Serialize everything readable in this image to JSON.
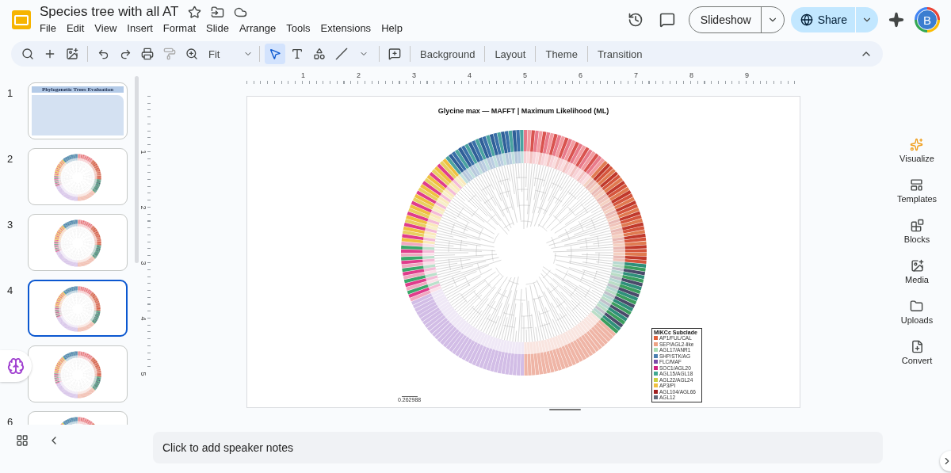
{
  "document": {
    "title": "Species tree with all AT"
  },
  "menu": [
    "File",
    "Edit",
    "View",
    "Insert",
    "Format",
    "Slide",
    "Arrange",
    "Tools",
    "Extensions",
    "Help"
  ],
  "header": {
    "slideshow": "Slideshow",
    "share": "Share",
    "avatar": "B"
  },
  "toolbar": {
    "zoom": "Fit",
    "pointer_selected": true,
    "buttons": [
      "Background",
      "Layout",
      "Theme",
      "Transition"
    ]
  },
  "slides": [
    {
      "number": "1",
      "kind": "title",
      "selected": false,
      "title": "Phylogenetic Trees Evaluation"
    },
    {
      "number": "2",
      "kind": "tree",
      "selected": false
    },
    {
      "number": "3",
      "kind": "tree",
      "selected": false
    },
    {
      "number": "4",
      "kind": "tree",
      "selected": true
    },
    {
      "kind": "tree",
      "selected": false
    },
    {
      "number": "6",
      "kind": "tree",
      "selected": false
    }
  ],
  "ruler": {
    "horizontal": [
      "1",
      "2",
      "3",
      "4",
      "5",
      "6",
      "7",
      "8",
      "9"
    ],
    "vertical": [
      "1",
      "2",
      "3",
      "4",
      "5"
    ]
  },
  "slide": {
    "title": "Glycine max — MAFFT | Maximum Likelihood (ML)",
    "scale": "0.262988",
    "legend": {
      "title": "MIKCc Subclade",
      "items": [
        {
          "label": "AP1/FUL/CAL",
          "color": "#e0603a"
        },
        {
          "label": "SEP/AGL2-like",
          "color": "#eda283"
        },
        {
          "label": "AGL17/ANR1",
          "color": "#a8dcb0"
        },
        {
          "label": "SHP/STK/AG",
          "color": "#4a7fb0"
        },
        {
          "label": "FLC/MAF",
          "color": "#7a4aa8"
        },
        {
          "label": "SOC1/AGL20",
          "color": "#d02080"
        },
        {
          "label": "AGL15/AGL18",
          "color": "#40a890"
        },
        {
          "label": "AGL22/AGL24",
          "color": "#c8d040"
        },
        {
          "label": "AP3/PI",
          "color": "#f0c040"
        },
        {
          "label": "AGL104/AGL66",
          "color": "#a02020"
        },
        {
          "label": "AGL12",
          "color": "#606878"
        }
      ]
    }
  },
  "side_panel": [
    {
      "label": "Visualize",
      "kind": "sparkles"
    },
    {
      "label": "Templates",
      "kind": "templates"
    },
    {
      "label": "Blocks",
      "kind": "blocks"
    },
    {
      "label": "Media",
      "kind": "media"
    },
    {
      "label": "Uploads",
      "kind": "uploads"
    },
    {
      "label": "Convert",
      "kind": "convert"
    }
  ],
  "notes": {
    "placeholder": "Click to add speaker notes"
  }
}
